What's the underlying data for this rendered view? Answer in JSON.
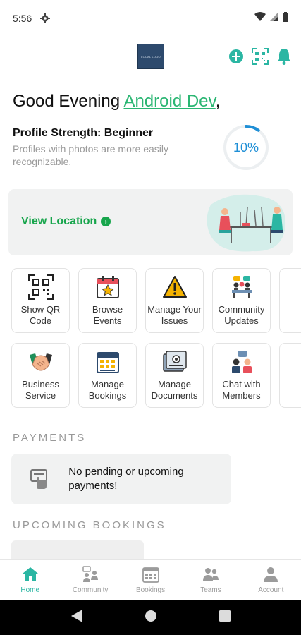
{
  "status_bar": {
    "time": "5:56"
  },
  "header": {
    "logo_text": "LOCAL LOGO"
  },
  "greeting": {
    "prefix": "Good Evening ",
    "name": "Android Dev",
    "suffix": ","
  },
  "profile": {
    "title": "Profile Strength: Beginner",
    "subtitle": "Profiles with photos are more easily recognizable.",
    "progress_label": "10%",
    "progress_value": 0.1
  },
  "banner": {
    "link_label": "View Location"
  },
  "tiles_row1": [
    {
      "label": "Show QR Code",
      "icon": "qr-code-icon"
    },
    {
      "label": "Browse Events",
      "icon": "calendar-star-icon"
    },
    {
      "label": "Manage Your Issues",
      "icon": "warning-icon"
    },
    {
      "label": "Community Updates",
      "icon": "community-meeting-icon"
    }
  ],
  "tiles_row2": [
    {
      "label": "Business Service",
      "icon": "handshake-icon"
    },
    {
      "label": "Manage Bookings",
      "icon": "booking-calendar-icon"
    },
    {
      "label": "Manage Documents",
      "icon": "documents-icon"
    },
    {
      "label": "Chat with Members",
      "icon": "chat-members-icon"
    }
  ],
  "payments": {
    "title": "PAYMENTS",
    "empty_text": "No pending or upcoming payments!"
  },
  "bookings": {
    "title": "UPCOMING BOOKINGS"
  },
  "bottom_nav": [
    {
      "label": "Home",
      "icon": "home-icon",
      "active": true
    },
    {
      "label": "Community",
      "icon": "community-icon",
      "active": false
    },
    {
      "label": "Bookings",
      "icon": "bookings-icon",
      "active": false
    },
    {
      "label": "Teams",
      "icon": "teams-icon",
      "active": false
    },
    {
      "label": "Account",
      "icon": "account-icon",
      "active": false
    }
  ],
  "colors": {
    "accent": "#2bb6a3",
    "green": "#17a54c",
    "progress": "#1f8fd6"
  }
}
